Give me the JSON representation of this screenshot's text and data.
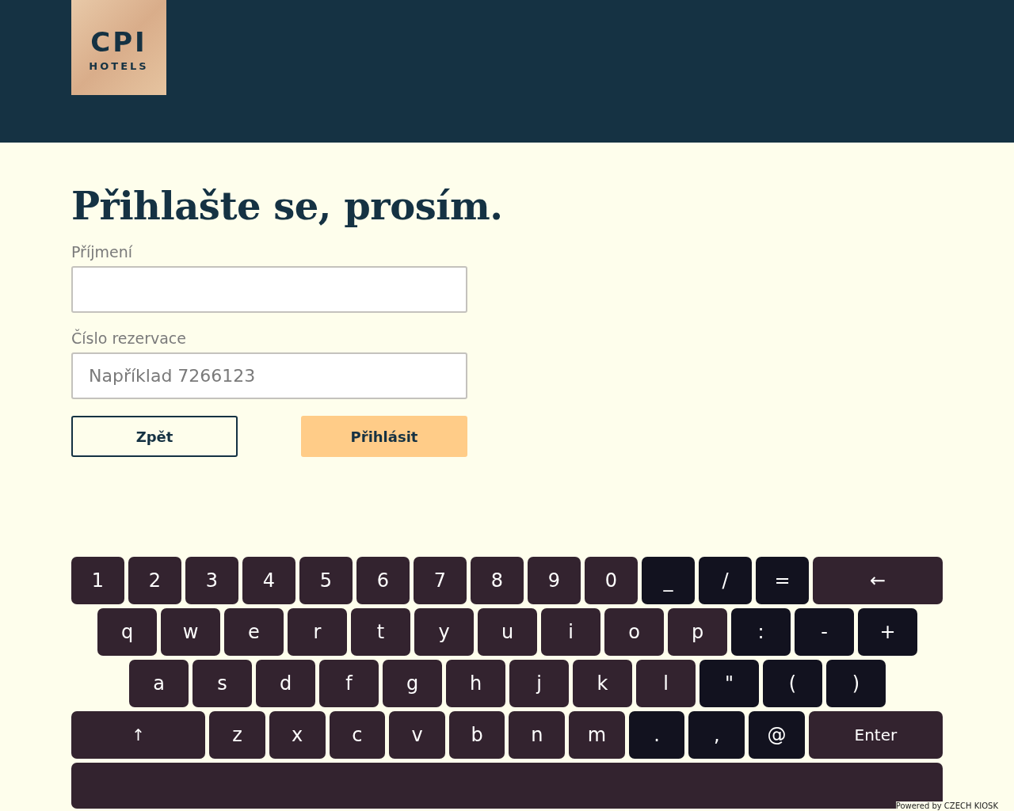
{
  "header": {
    "logo": {
      "title": "CPI",
      "subtitle": "HOTELS"
    }
  },
  "login": {
    "heading": "Přihlašte se, prosím.",
    "fields": [
      {
        "label": "Příjmení"
      },
      {
        "label": "Číslo rezervace",
        "placeholder": "Například 7266123"
      }
    ],
    "buttons": [
      {
        "label": "Zpět",
        "kind": "secondary"
      },
      {
        "label": "Přihlásit",
        "kind": "primary"
      }
    ]
  },
  "keyboard": {
    "rows": [
      [
        {
          "key": "1",
          "kind": "char"
        },
        {
          "key": "2",
          "kind": "char"
        },
        {
          "key": "3",
          "kind": "char"
        },
        {
          "key": "4",
          "kind": "char"
        },
        {
          "key": "5",
          "kind": "char"
        },
        {
          "key": "6",
          "kind": "char"
        },
        {
          "key": "7",
          "kind": "char"
        },
        {
          "key": "8",
          "kind": "char"
        },
        {
          "key": "9",
          "kind": "char"
        },
        {
          "key": "0",
          "kind": "char"
        },
        {
          "key": "_",
          "kind": "symbol"
        },
        {
          "key": "/",
          "kind": "symbol"
        },
        {
          "key": "=",
          "kind": "symbol"
        },
        {
          "key": "←",
          "kind": "backspace"
        }
      ],
      [
        {
          "key": "q",
          "kind": "char"
        },
        {
          "key": "w",
          "kind": "char"
        },
        {
          "key": "e",
          "kind": "char"
        },
        {
          "key": "r",
          "kind": "char"
        },
        {
          "key": "t",
          "kind": "char"
        },
        {
          "key": "y",
          "kind": "char"
        },
        {
          "key": "u",
          "kind": "char"
        },
        {
          "key": "i",
          "kind": "char"
        },
        {
          "key": "o",
          "kind": "char"
        },
        {
          "key": "p",
          "kind": "char"
        },
        {
          "key": ":",
          "kind": "symbol"
        },
        {
          "key": "-",
          "kind": "symbol"
        },
        {
          "key": "+",
          "kind": "symbol"
        }
      ],
      [
        {
          "key": "a",
          "kind": "char"
        },
        {
          "key": "s",
          "kind": "char"
        },
        {
          "key": "d",
          "kind": "char"
        },
        {
          "key": "f",
          "kind": "char"
        },
        {
          "key": "g",
          "kind": "char"
        },
        {
          "key": "h",
          "kind": "char"
        },
        {
          "key": "j",
          "kind": "char"
        },
        {
          "key": "k",
          "kind": "char"
        },
        {
          "key": "l",
          "kind": "char"
        },
        {
          "key": "\"",
          "kind": "symbol"
        },
        {
          "key": "(",
          "kind": "symbol"
        },
        {
          "key": ")",
          "kind": "symbol"
        }
      ],
      [
        {
          "key": "↑",
          "kind": "shift"
        },
        {
          "key": "z",
          "kind": "char"
        },
        {
          "key": "x",
          "kind": "char"
        },
        {
          "key": "c",
          "kind": "char"
        },
        {
          "key": "v",
          "kind": "char"
        },
        {
          "key": "b",
          "kind": "char"
        },
        {
          "key": "n",
          "kind": "char"
        },
        {
          "key": "m",
          "kind": "char"
        },
        {
          "key": ".",
          "kind": "symbol"
        },
        {
          "key": ",",
          "kind": "symbol"
        },
        {
          "key": "@",
          "kind": "symbol"
        },
        {
          "key": "Enter",
          "kind": "enter"
        }
      ],
      [
        {
          "kind": "space"
        }
      ]
    ]
  },
  "footer": {
    "text": "Powered by CZECH KIOSK"
  }
}
